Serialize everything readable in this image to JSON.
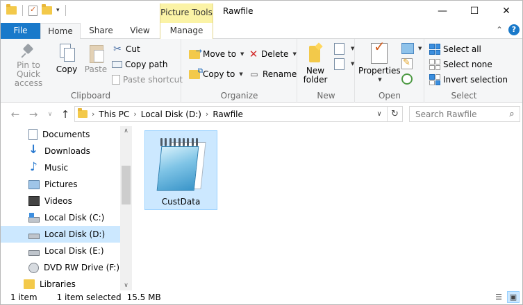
{
  "window": {
    "title": "Rawfile",
    "contextual_tab_header": "Picture Tools",
    "controls": {
      "minimize": "—",
      "maximize": "☐",
      "close": "✕"
    }
  },
  "ribbon_tabs": [
    "File",
    "Home",
    "Share",
    "View",
    "Manage"
  ],
  "ribbon_right": {
    "collapse": "⌃",
    "help": "?"
  },
  "clipboard": {
    "label": "Clipboard",
    "pin": "Pin to Quick access",
    "copy": "Copy",
    "paste": "Paste",
    "cut": "Cut",
    "copy_path": "Copy path",
    "paste_shortcut": "Paste shortcut"
  },
  "organize": {
    "label": "Organize",
    "move_to": "Move to",
    "copy_to": "Copy to",
    "delete": "Delete",
    "rename": "Rename"
  },
  "new_group": {
    "label": "New",
    "new_folder": "New folder"
  },
  "open_group": {
    "label": "Open",
    "properties": "Properties"
  },
  "select_group": {
    "label": "Select",
    "select_all": "Select all",
    "select_none": "Select none",
    "invert_selection": "Invert selection"
  },
  "address": {
    "segments": [
      "This PC",
      "Local Disk (D:)",
      "Rawfile"
    ],
    "separator": "›"
  },
  "search": {
    "placeholder": "Search Rawfile"
  },
  "nav_pane": {
    "items": [
      {
        "label": "Documents",
        "icon": "documents-icon"
      },
      {
        "label": "Downloads",
        "icon": "downloads-icon"
      },
      {
        "label": "Music",
        "icon": "music-icon"
      },
      {
        "label": "Pictures",
        "icon": "pictures-icon"
      },
      {
        "label": "Videos",
        "icon": "videos-icon"
      },
      {
        "label": "Local Disk (C:)",
        "icon": "drive-icon"
      },
      {
        "label": "Local Disk (D:)",
        "icon": "drive-icon",
        "selected": true
      },
      {
        "label": "Local Disk (E:)",
        "icon": "drive-icon"
      },
      {
        "label": "DVD RW Drive (F:)",
        "icon": "dvd-icon"
      },
      {
        "label": "Libraries",
        "icon": "libraries-icon"
      }
    ]
  },
  "files": [
    {
      "name": "CustData",
      "icon": "notepad-icon",
      "selected": true
    }
  ],
  "status": {
    "count": "1 item",
    "selected": "1 item selected",
    "size": "15.5 MB"
  },
  "colors": {
    "file_tab": "#1979ca",
    "selection": "#cce8ff",
    "contextual": "#fbf3a6"
  }
}
